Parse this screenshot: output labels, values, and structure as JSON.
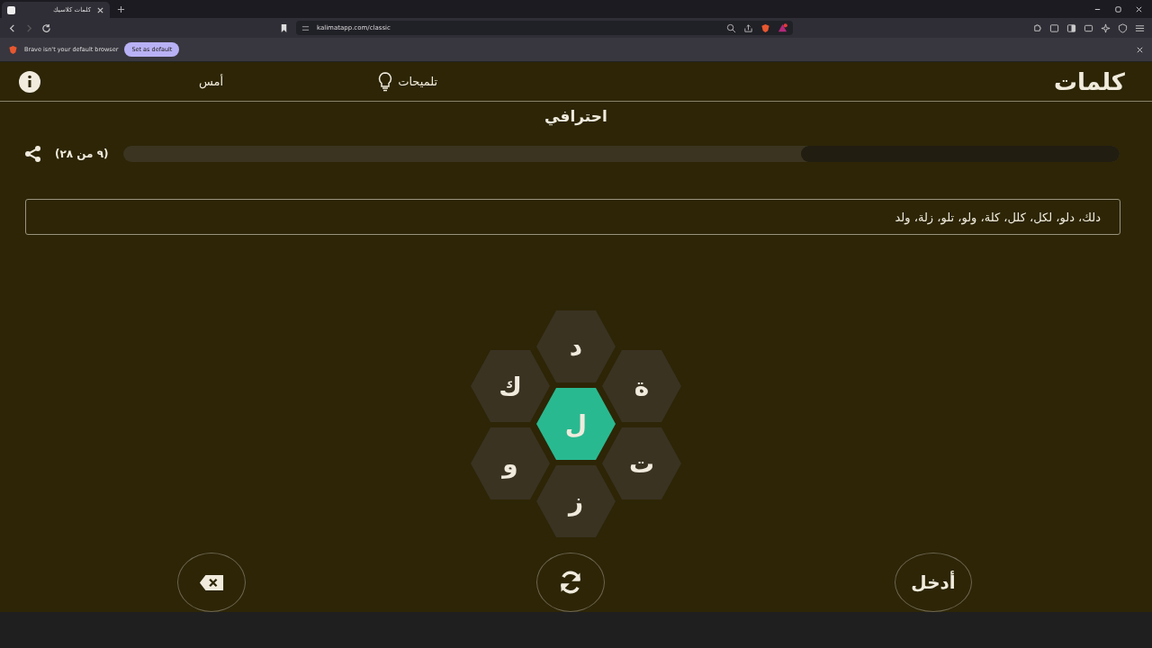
{
  "browser": {
    "tab_title": "كلمات كلاسيك",
    "url": "kalimatapp.com/classic",
    "infobar_text": "Brave isn't your default browser",
    "infobar_button": "Set as default"
  },
  "header": {
    "logo": "كلمات",
    "hints": "تلميحات",
    "yesterday": "أمس"
  },
  "level_title": "احترافي",
  "progress": {
    "label": "(٩ من ٢٨)",
    "level": 0.32
  },
  "found_words": "دلك، دلو، لكل، كلل، كلة، ولو، تلو، زلة، ولد",
  "center_letter": "ل",
  "outer_letters": [
    "د",
    "ة",
    "ت",
    "ز",
    "و",
    "ك"
  ],
  "enter_button": "أدخل"
}
